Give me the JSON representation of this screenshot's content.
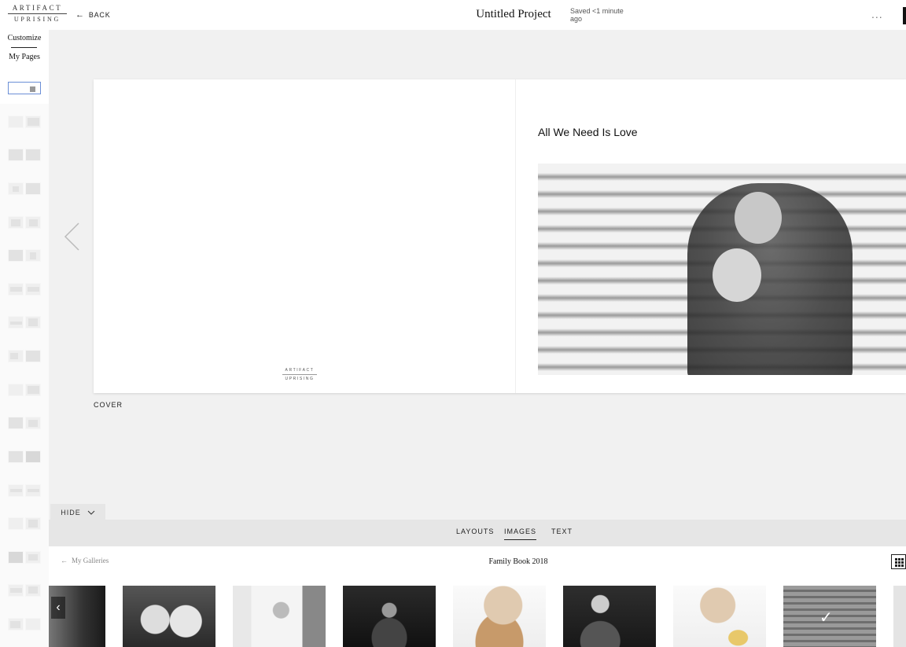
{
  "header": {
    "logo_line1": "ARTIFACT",
    "logo_line2": "UPRISING",
    "back_label": "BACK",
    "project_title": "Untitled Project",
    "saved_status": "Saved <1 minute ago",
    "more_label": "..."
  },
  "rail": {
    "tabs": [
      {
        "label": "Customize"
      },
      {
        "label": "My Pages"
      }
    ]
  },
  "spread": {
    "cover_logo_line1": "ARTIFACT",
    "cover_logo_line2": "UPRISING",
    "page_title": "All We Need Is Love",
    "page_label": "COVER"
  },
  "tray": {
    "hide_label": "HIDE",
    "tabs": [
      {
        "label": "LAYOUTS"
      },
      {
        "label": "IMAGES"
      },
      {
        "label": "TEXT"
      }
    ],
    "back_label": "My Galleries",
    "gallery_title": "Family Book 2018"
  },
  "colors": {
    "canvas": "#f1f1f1",
    "active_outline": "#6b8fd6",
    "ink": "#222222"
  }
}
